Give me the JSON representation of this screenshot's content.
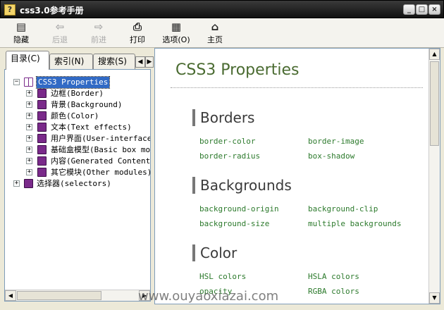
{
  "window": {
    "title": "css3.0参考手册",
    "minimize": "_",
    "maximize": "□",
    "close": "×",
    "app_icon": "?"
  },
  "toolbar": {
    "buttons": [
      {
        "label": "隐藏",
        "icon": "hide-icon",
        "glyph": "▤",
        "enabled": true
      },
      {
        "label": "后退",
        "icon": "back-arrow-icon",
        "glyph": "⇦",
        "enabled": false
      },
      {
        "label": "前进",
        "icon": "forward-arrow-icon",
        "glyph": "⇨",
        "enabled": false
      },
      {
        "label": "打印",
        "icon": "printer-icon",
        "glyph": "⎙",
        "enabled": true
      },
      {
        "label": "选项(O)",
        "icon": "options-icon",
        "glyph": "▦",
        "enabled": true
      },
      {
        "label": "主页",
        "icon": "home-page-icon",
        "glyph": "⌂",
        "enabled": true
      }
    ]
  },
  "nav_tabs": [
    {
      "label": "目录(C)",
      "active": true
    },
    {
      "label": "索引(N)",
      "active": false
    },
    {
      "label": "搜索(S)",
      "active": false
    }
  ],
  "tab_scroll": {
    "left": "◀",
    "right": "▶"
  },
  "tree": {
    "root": {
      "label": "CSS3 Properties",
      "expander": "−"
    },
    "children": [
      {
        "label": "边框(Border)",
        "expander": "+"
      },
      {
        "label": "背景(Background)",
        "expander": "+"
      },
      {
        "label": "颜色(Color)",
        "expander": "+"
      },
      {
        "label": "文本(Text effects)",
        "expander": "+"
      },
      {
        "label": "用户界面(User-interface",
        "expander": "+"
      },
      {
        "label": "基础盒模型(Basic box mo",
        "expander": "+"
      },
      {
        "label": "内容(Generated Content)",
        "expander": "+"
      },
      {
        "label": "其它模块(Other modules)",
        "expander": "+"
      }
    ],
    "sibling": {
      "label": "选择器(selectors)",
      "expander": "+"
    }
  },
  "scroll_glyphs": {
    "left": "◀",
    "right": "▶",
    "up": "▲",
    "down": "▼"
  },
  "content": {
    "title": "CSS3 Properties",
    "sections": [
      {
        "heading": "Borders",
        "links": [
          "border-color",
          "border-image",
          "border-radius",
          "box-shadow"
        ]
      },
      {
        "heading": "Backgrounds",
        "links": [
          "background-origin",
          "background-clip",
          "background-size",
          "multiple backgrounds"
        ]
      },
      {
        "heading": "Color",
        "links": [
          "HSL colors",
          "HSLA colors",
          "opacity",
          "RGBA colors"
        ]
      }
    ]
  },
  "watermark": "www.ouyaoxiazai.com",
  "colors": {
    "accent_green": "#4a6b31",
    "link_green": "#2c7a2c",
    "book_purple": "#7a2a8a",
    "selection_blue": "#316ac5"
  }
}
